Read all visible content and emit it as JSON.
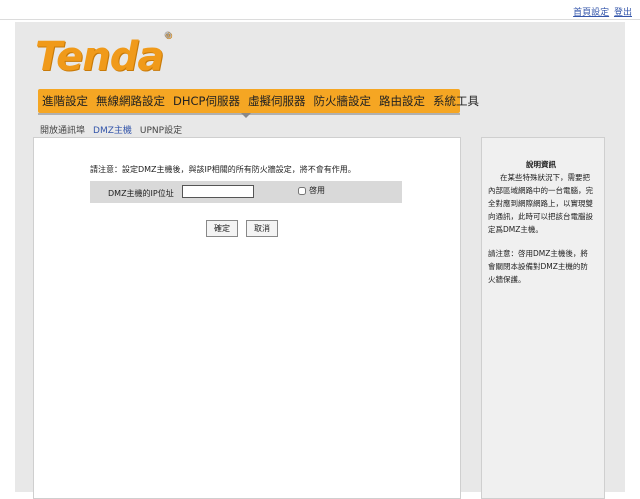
{
  "top_links": {
    "home": "首頁設定",
    "logout": "登出"
  },
  "logo": {
    "text": "Tenda",
    "mark": "®"
  },
  "nav": {
    "items": [
      {
        "label": "進階設定"
      },
      {
        "label": "無線網路設定"
      },
      {
        "label": "DHCP伺服器"
      },
      {
        "label": "虛擬伺服器"
      },
      {
        "label": "防火牆設定"
      },
      {
        "label": "路由設定"
      },
      {
        "label": "系統工具"
      }
    ],
    "active_index": 3
  },
  "subnav": {
    "items": [
      {
        "label": "開放通訊埠"
      },
      {
        "label": "DMZ主機"
      },
      {
        "label": "UPNP設定"
      }
    ],
    "active_index": 1
  },
  "form": {
    "notice": "請注意：設定DMZ主機後，與該IP相關的所有防火牆設定，將不會有作用。",
    "ip_label": "DMZ主機的IP位址",
    "ip_value": "",
    "enable_label": "啓用",
    "enable_checked": false,
    "confirm_label": "確定",
    "cancel_label": "取消"
  },
  "help": {
    "title": "說明資訊",
    "para1": "在某些特殊狀況下，需要把內部區域網路中的一台電腦，完全對應到網際網路上，以實現雙向通訊，此時可以把該台電腦設定爲DMZ主機。",
    "para2": "請注意：啓用DMZ主機後，將會關閉本設備對DMZ主機的防火牆保護。"
  }
}
